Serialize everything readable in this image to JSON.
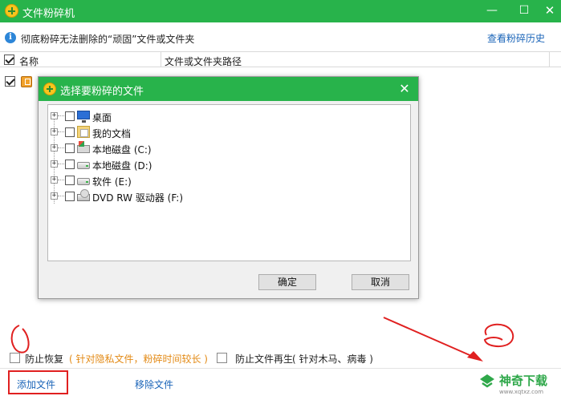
{
  "window": {
    "title": "文件粉碎机",
    "min_glyph": "—",
    "max_glyph": "☐",
    "close_glyph": "✕",
    "brand_color": "#28b34b"
  },
  "infobar": {
    "icon_glyph": "i",
    "text": "彻底粉碎无法删除的“顽固”文件或文件夹",
    "history_link": "查看粉碎历史"
  },
  "list": {
    "columns": [
      "名称",
      "文件或文件夹路径"
    ],
    "rows": [
      {
        "checked": true,
        "icon": "file-icon",
        "name": "",
        "path": ""
      }
    ]
  },
  "options": [
    {
      "label": "防止恢复",
      "note": "( 针对隐私文件，粉碎时间较长 )",
      "checked": false
    },
    {
      "label": "防止文件再生",
      "note": "( 针对木马、病毒 )",
      "checked": false
    }
  ],
  "footer": {
    "add_button": "添加文件",
    "remove_button": "移除文件",
    "watermark": "神奇下载",
    "watermark_url": "www.xqtxz.com"
  },
  "dialog": {
    "title": "选择要粉碎的文件",
    "close_glyph": "✕",
    "expander_glyph": "+",
    "tree": [
      {
        "label": "桌面",
        "icon": "desktop-icon"
      },
      {
        "label": "我的文档",
        "icon": "documents-folder-icon"
      },
      {
        "label": "本地磁盘 (C:)",
        "icon": "system-drive-icon"
      },
      {
        "label": "本地磁盘 (D:)",
        "icon": "drive-icon"
      },
      {
        "label": "软件 (E:)",
        "icon": "drive-icon"
      },
      {
        "label": "DVD RW 驱动器 (F:)",
        "icon": "dvd-drive-icon"
      }
    ],
    "ok_button": "确定",
    "cancel_button": "取消"
  },
  "annotation_color": "#e02020"
}
